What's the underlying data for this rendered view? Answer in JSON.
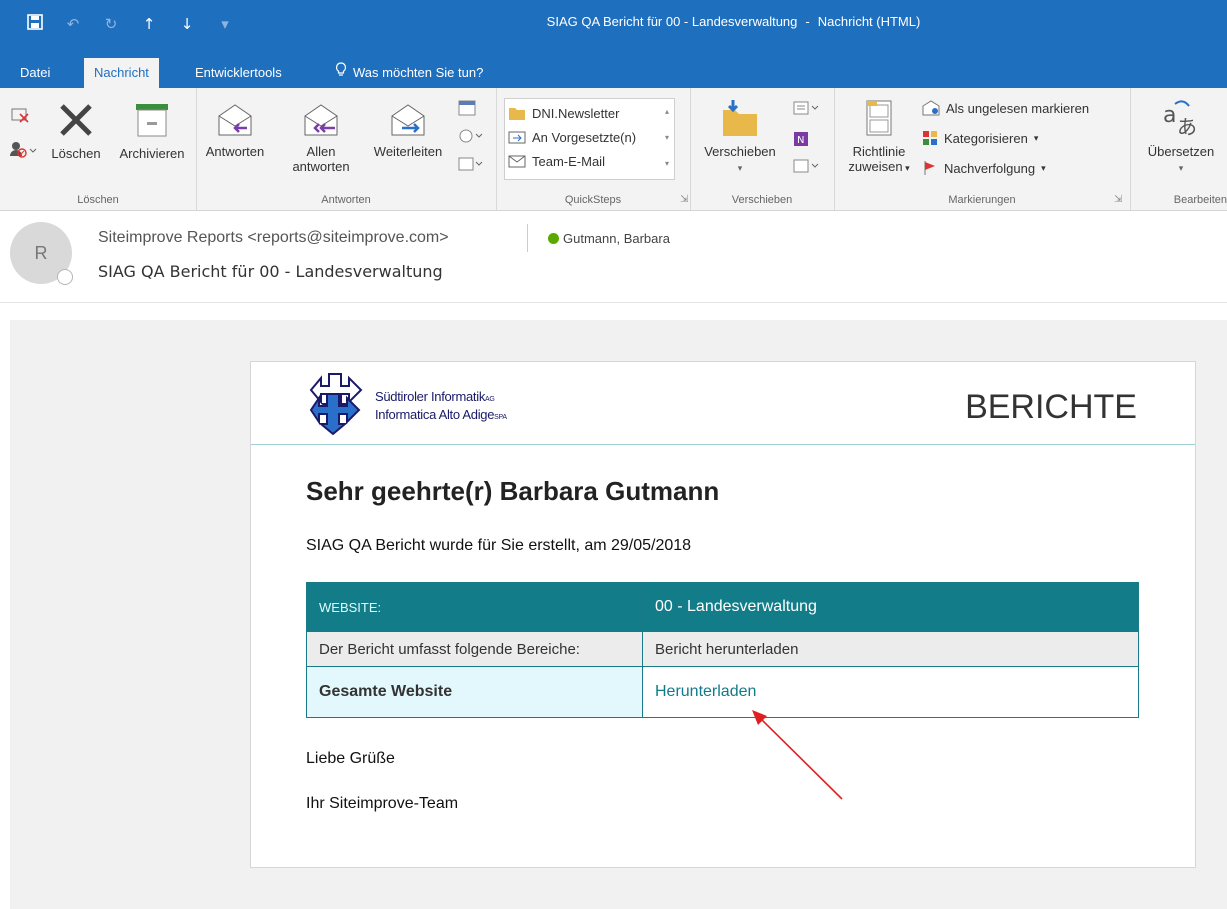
{
  "window": {
    "title": "SIAG QA Bericht für 00 - Landesverwaltung",
    "sep": "-",
    "mode": "Nachricht (HTML)"
  },
  "ribbon_tabs": [
    "Datei",
    "Nachricht",
    "Entwicklertools",
    "Was möchten Sie tun?"
  ],
  "groups": {
    "loeschen": {
      "label": "Löschen",
      "delete": "Löschen",
      "archive": "Archivieren"
    },
    "antworten": {
      "label": "Antworten",
      "reply": "Antworten",
      "reply_all_1": "Allen",
      "reply_all_2": "antworten",
      "forward": "Weiterleiten"
    },
    "quicksteps": {
      "label": "QuickSteps",
      "items": [
        "DNI.Newsletter",
        "An Vorgesetzte(n)",
        "Team-E-Mail"
      ]
    },
    "verschieben": {
      "label": "Verschieben",
      "move": "Verschieben"
    },
    "markierungen": {
      "label": "Markierungen",
      "policy_1": "Richtlinie",
      "policy_2": "zuweisen",
      "unread": "Als ungelesen markieren",
      "categorize": "Kategorisieren",
      "followup": "Nachverfolgung"
    },
    "bearbeiten": {
      "label": "Bearbeiten",
      "translate": "Übersetzen"
    }
  },
  "message": {
    "avatar_initial": "R",
    "sender": "Siteimprove Reports <reports@siteimprove.com>",
    "recipient": "Gutmann, Barbara",
    "subject": "SIAG QA Bericht für 00 - Landesverwaltung"
  },
  "email": {
    "logo_line1": "Südtiroler Informatik",
    "logo_line1_suffix": "AG",
    "logo_line2": "Informatica Alto Adige",
    "logo_line2_suffix": "SPA",
    "header_title": "BERICHTE",
    "greeting": "Sehr geehrte(r) Barbara Gutmann",
    "intro": "SIAG QA Bericht wurde für Sie erstellt, am 29/05/2018",
    "table": [
      [
        "WEBSITE:",
        "00 - Landesverwaltung"
      ],
      [
        "Der Bericht umfasst folgende Bereiche:",
        "Bericht herunterladen"
      ],
      [
        "Gesamte Website",
        "Herunterladen"
      ]
    ],
    "closing": "Liebe Grüße",
    "signature": "Ihr Siteimprove-Team"
  },
  "colors": {
    "ribbon_blue": "#1f6fbf",
    "table_teal": "#127d88",
    "link_teal": "#117a88",
    "arrow_red": "#e02020"
  }
}
